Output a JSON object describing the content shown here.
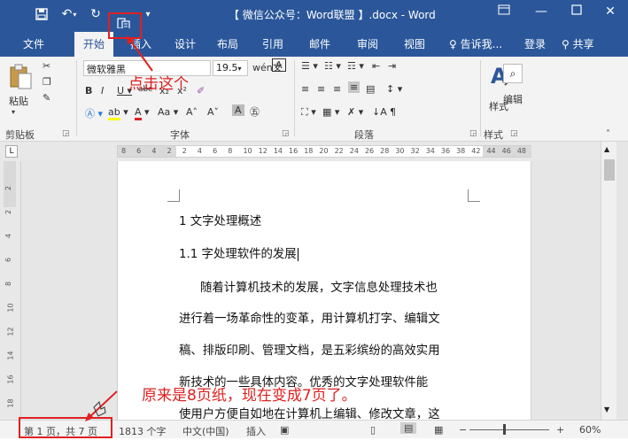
{
  "titlebar": {
    "title": "【 微信公众号：Word联盟 】.docx  -  Word",
    "minimize": "—",
    "close": "✕"
  },
  "tabs": [
    "文件",
    "开始",
    "插入",
    "设计",
    "布局",
    "引用",
    "邮件",
    "审阅",
    "视图"
  ],
  "tell_me": "告诉我...",
  "login": "登录",
  "share": "共享",
  "ribbon": {
    "paste_label": "粘贴",
    "font_name": "微软雅黑",
    "font_size": "19.5",
    "font_group": "字体",
    "clipboard_group": "剪贴板",
    "paragraph_group": "段落",
    "styles_group": "样式",
    "styles_label": "样式",
    "edit_label": "编辑"
  },
  "annotations": {
    "click_this": "点击这个",
    "was_pages": "原来是8页纸，现在变成7页了。"
  },
  "ruler": {
    "ticks": [
      "8",
      "6",
      "4",
      "2",
      "2",
      "4",
      "6",
      "8",
      "10",
      "12",
      "14",
      "16",
      "18",
      "20",
      "22",
      "24",
      "26",
      "28",
      "30",
      "32",
      "34",
      "36",
      "38",
      "42",
      "44",
      "46",
      "48"
    ]
  },
  "vruler": [
    "2",
    "2",
    "4",
    "6",
    "8",
    "10",
    "12",
    "14",
    "16",
    "18"
  ],
  "document": {
    "lines": [
      "1 文字处理概述",
      "1.1  字处理软件的发展",
      "随着计算机技术的发展，文字信息处理技术也",
      "进行着一场革命性的变革，用计算机打字、编辑文",
      "稿、排版印刷、管理文档，是五彩缤纷的高效实用",
      "新技术的一些具体内容。优秀的文字处理软件能",
      "使用户方便自如地在计算机上编辑、修改文章，这"
    ]
  },
  "status": {
    "page": "第 1 页，共 7 页",
    "words": "1813 个字",
    "lang": "中文(中国)",
    "insert": "插入",
    "zoom": "60%"
  },
  "colors": {
    "brand": "#2b579a",
    "annotation": "#e02020"
  }
}
